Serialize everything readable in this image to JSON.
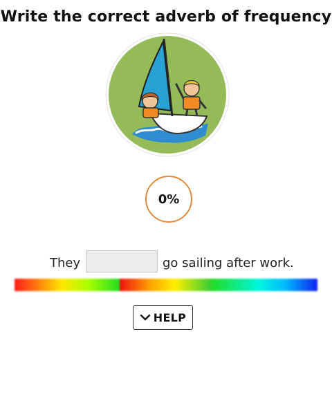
{
  "title": "Write the correct adverb of frequency",
  "illustration": {
    "icon": "sailing-kids-icon"
  },
  "progress": {
    "text": "0%",
    "value": 0,
    "color": "#e08a3c"
  },
  "sentence": {
    "before": "They",
    "answer_value": "",
    "after": "go sailing after work."
  },
  "help_button": {
    "label": "HELP",
    "icon": "chevron-down-icon"
  },
  "colors": {
    "title": "#111111",
    "input_bg": "#ececec",
    "circle_bg": "#95bb58"
  }
}
